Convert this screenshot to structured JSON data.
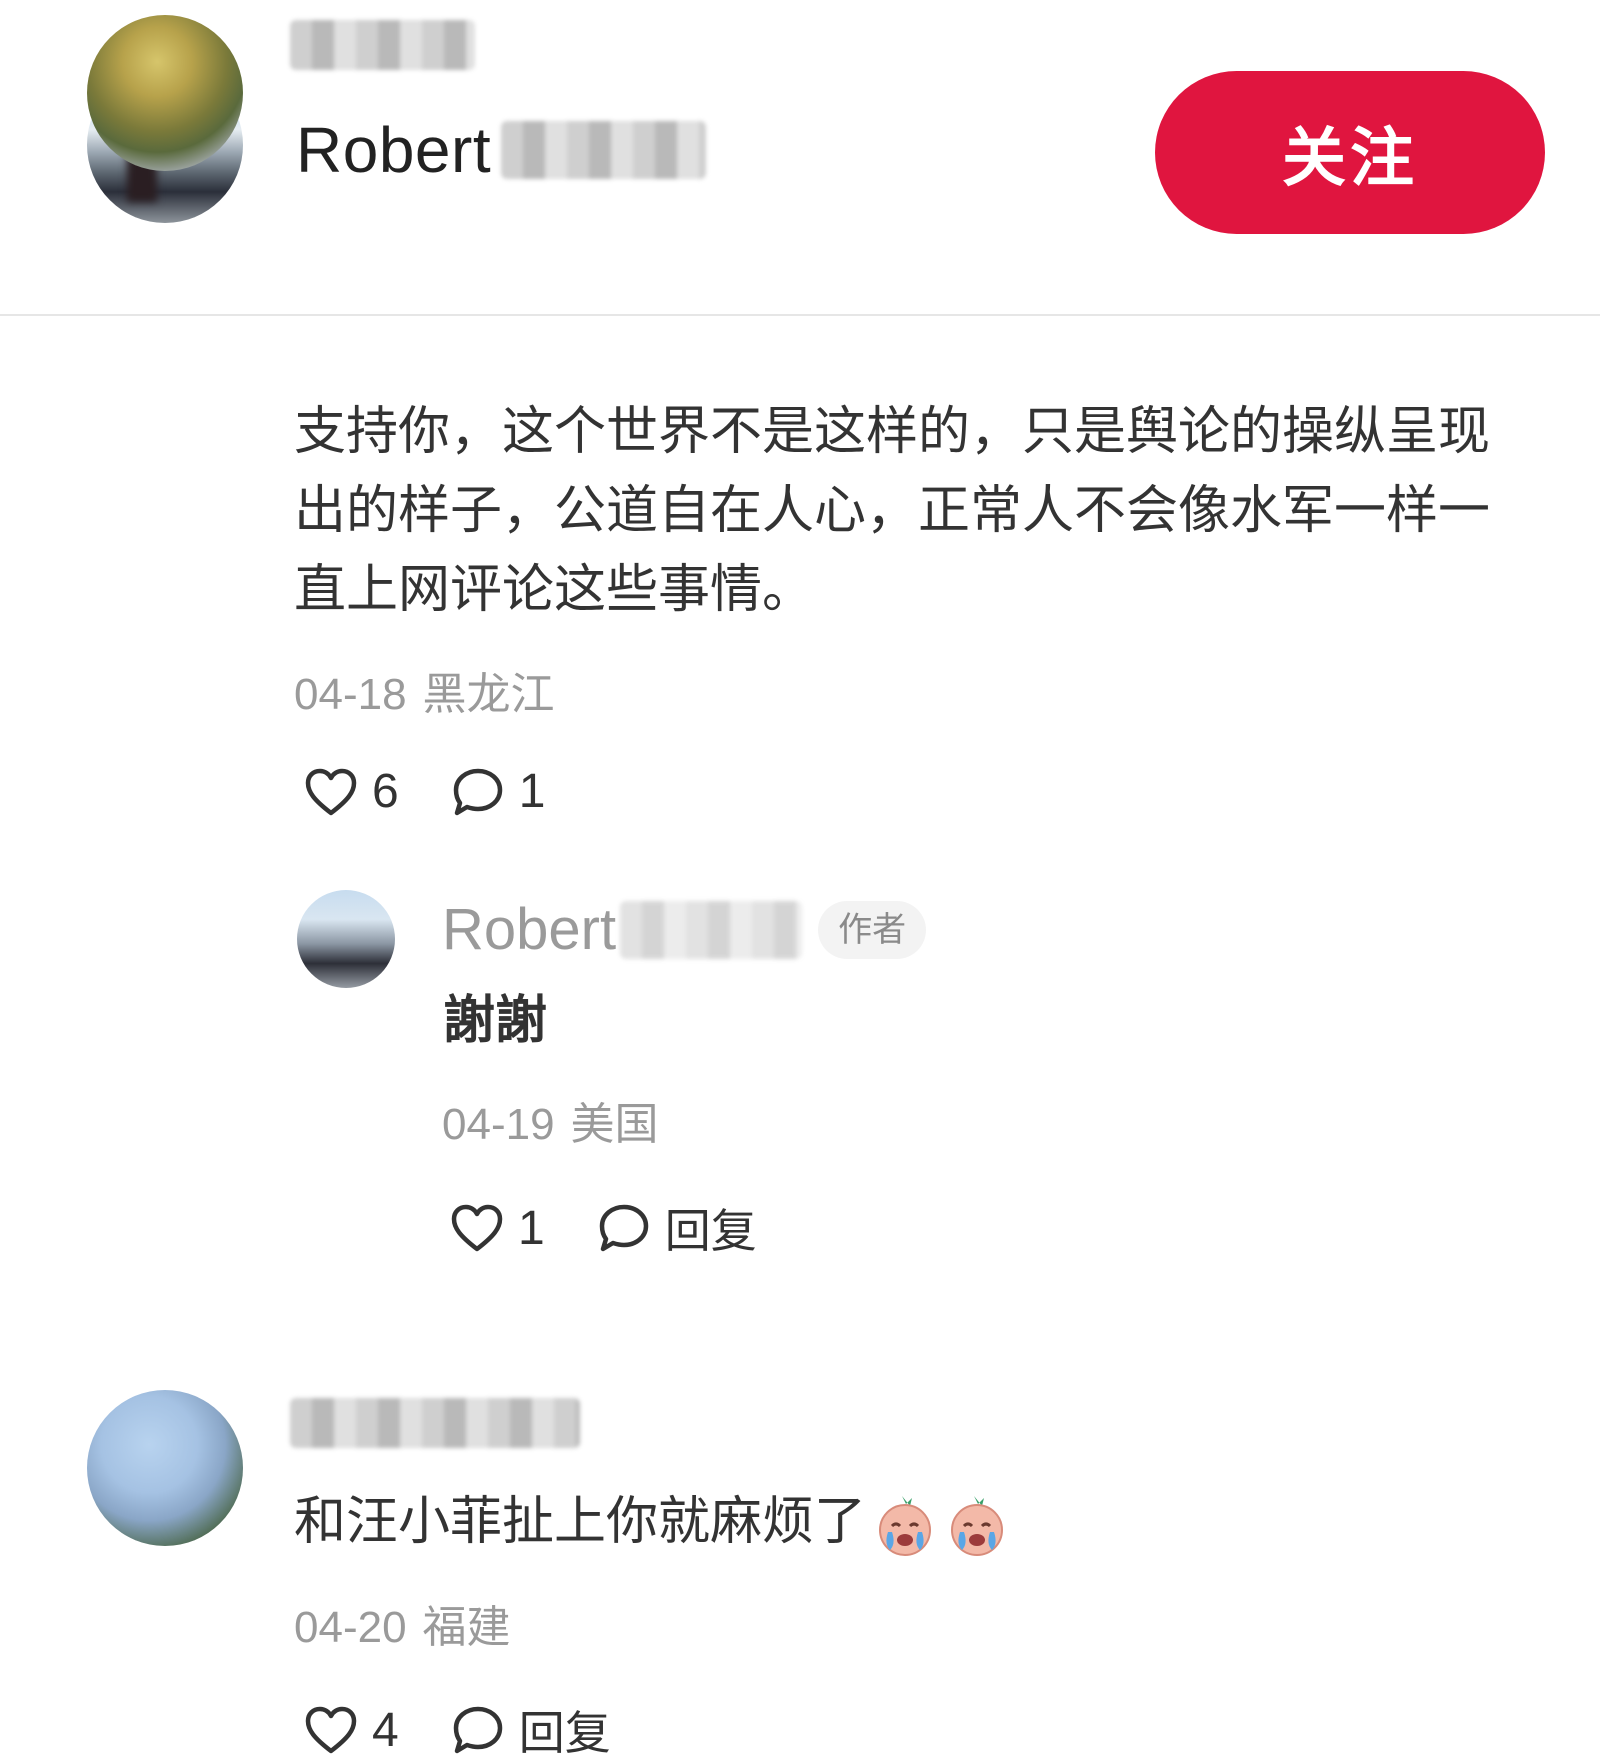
{
  "header": {
    "author_name": "Robert",
    "follow_label": "关注"
  },
  "comments": [
    {
      "text": "支持你，这个世界不是这样的，只是舆论的操纵呈现出的样子，公道自在人心，正常人不会像水军一样一直上网评论这些事情。",
      "date": "04-18",
      "location": "黑龙江",
      "likes": "6",
      "replies": "1",
      "reply": {
        "author_name": "Robert",
        "badge": "作者",
        "text": "謝謝",
        "date": "04-19",
        "location": "美国",
        "likes": "1",
        "reply_label": "回复"
      }
    },
    {
      "text": "和汪小菲扯上你就麻烦了",
      "emoji": [
        "crying-face",
        "crying-face"
      ],
      "date": "04-20",
      "location": "福建",
      "likes": "4",
      "reply_label": "回复"
    }
  ],
  "icons": [
    "heart-icon",
    "comment-icon"
  ],
  "colors": {
    "accent": "#e0153f",
    "meta_text": "#9a9a9a",
    "body_text": "#333333"
  }
}
